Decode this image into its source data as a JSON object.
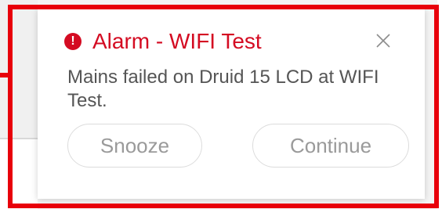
{
  "notification": {
    "title": "Alarm - WIFI Test",
    "message": "Mains failed on Druid 15 LCD at WIFI Test.",
    "icon": "alert-circle-icon",
    "close_icon": "close-icon",
    "buttons": {
      "snooze": "Snooze",
      "continue": "Continue"
    }
  },
  "colors": {
    "alert": "#d40b22",
    "highlight_frame": "#e8000b",
    "button_text": "#9a9a9a",
    "message_text": "#555555"
  }
}
